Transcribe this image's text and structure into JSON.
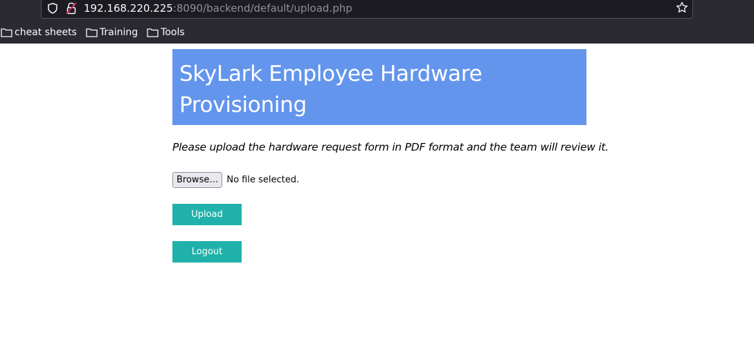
{
  "browser": {
    "url_host": "192.168.220.225",
    "url_path": ":8090/backend/default/upload.php",
    "bookmarks": [
      {
        "label": "cheat sheets"
      },
      {
        "label": "Training"
      },
      {
        "label": "Tools"
      }
    ]
  },
  "page": {
    "title": "SkyLark Employee Hardware Provisioning",
    "instruction": "Please upload the hardware request form in PDF format and the team will review it.",
    "file_input": {
      "button_label": "Browse…",
      "status": "No file selected."
    },
    "upload_label": "Upload",
    "logout_label": "Logout",
    "colors": {
      "header_bg": "#6495ed",
      "button_bg": "#20b2aa"
    }
  }
}
